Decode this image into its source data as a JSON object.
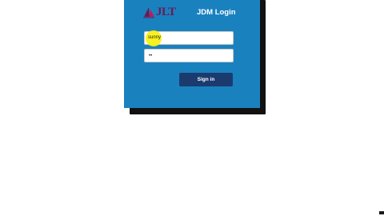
{
  "login": {
    "logo_text": "JLT",
    "title": "JDM Login",
    "username_value": "sunny",
    "password_value": "••",
    "signin_label": "Sign in"
  },
  "colors": {
    "panel": "#1a81bf",
    "button": "#1b3b6f",
    "logo": "#6a1b55",
    "cursor_highlight": "#faf014"
  },
  "icons": {
    "logo": "jlt-sail-logo"
  }
}
